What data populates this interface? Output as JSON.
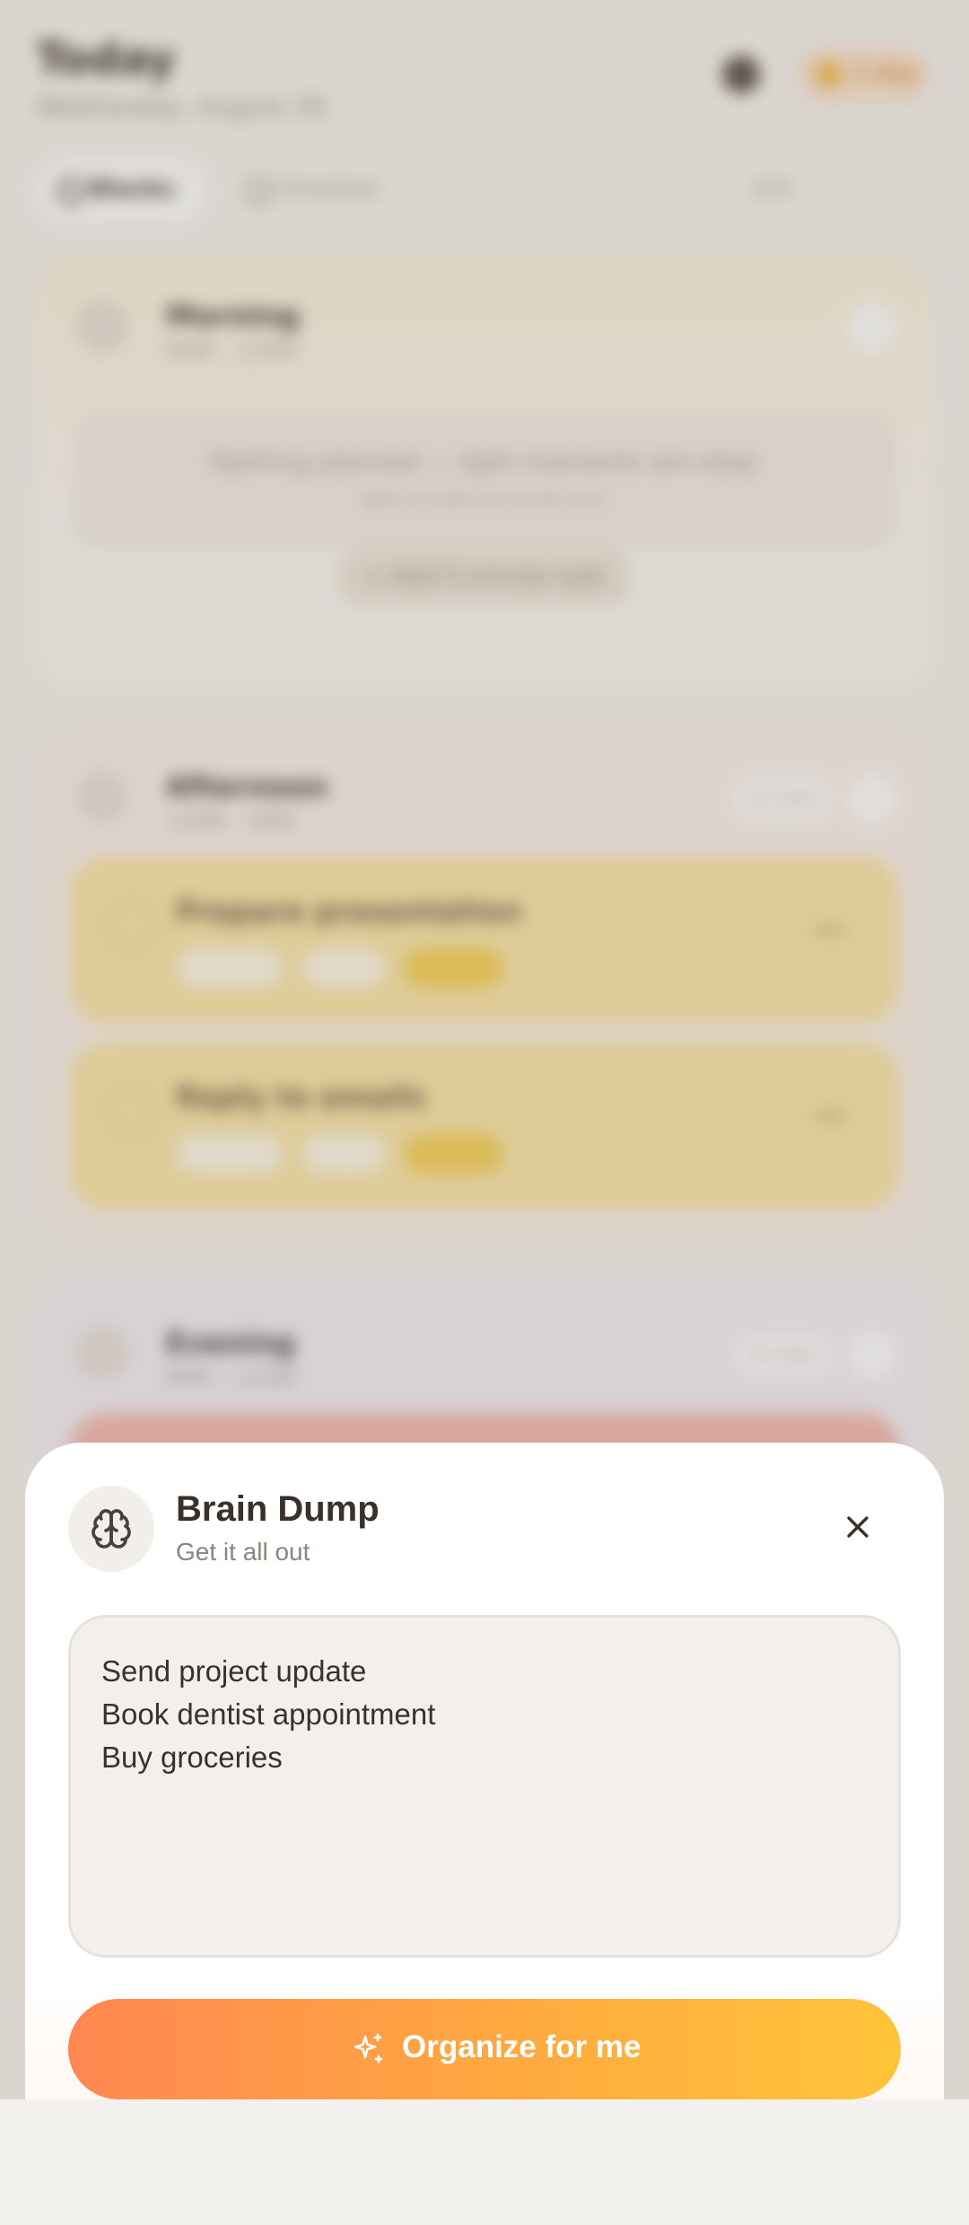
{
  "background": {
    "title": "Today",
    "date": "Wednesday, August 28",
    "streak": "3 day",
    "tabs": [
      {
        "label": "Blocks",
        "active": true
      },
      {
        "label": "Timeline",
        "active": false
      }
    ],
    "tab_right": "0/4",
    "blocks": {
      "morning": {
        "title": "Morning",
        "time": "6AM – 12PM",
        "empty_main": "Nothing planned — light moments are okay",
        "empty_sub": "Want to add one small win?",
        "add_label": "+ Add 5-minute task"
      },
      "afternoon": {
        "title": "Afternoon",
        "time": "12PM – 6PM",
        "pill": "1h 10m",
        "tasks": [
          {
            "name": "Prepare presentation"
          },
          {
            "name": "Reply to emails"
          }
        ]
      },
      "evening": {
        "title": "Evening",
        "time": "6PM – 12AM",
        "pill": "2h 30m"
      }
    }
  },
  "sheet": {
    "title": "Brain Dump",
    "subtitle": "Get it all out",
    "icon": "brain-icon",
    "input_lines": [
      "Send project update",
      "Book dentist appointment",
      "Buy groceries"
    ],
    "button_label": "Organize for me",
    "button_icon": "sparkle-icon"
  },
  "colors": {
    "accent_start": "#ff8752",
    "accent_end": "#ffc43a",
    "sheet_bg": "#ffffff",
    "input_bg": "#f3f0eb"
  }
}
